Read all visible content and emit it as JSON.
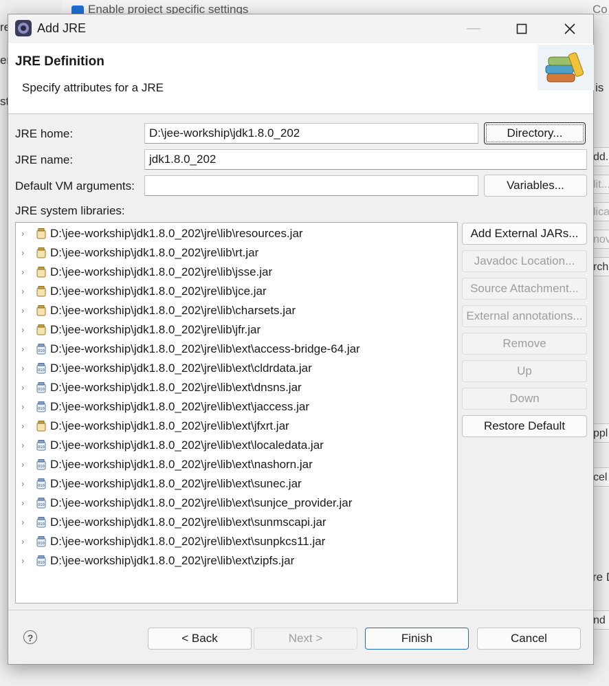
{
  "background": {
    "checkbox_label": "Enable project specific settings",
    "left_fragments": [
      "re",
      "er",
      "st"
    ],
    "right_fragments": [
      "is",
      "dd...",
      "lit...",
      "lica",
      "nov",
      "rch",
      "ppl",
      "cel",
      "re D",
      "nd C"
    ],
    "right_top": "Co"
  },
  "dialog": {
    "title": "Add JRE",
    "header_title": "JRE Definition",
    "header_subtitle": "Specify attributes for a JRE",
    "jre_home_label": "JRE home:",
    "jre_home_value": "D:\\jee-workship\\jdk1.8.0_202",
    "directory_button": "Directory...",
    "jre_name_label": "JRE name:",
    "jre_name_value": "jdk1.8.0_202",
    "vm_args_label": "Default VM arguments:",
    "vm_args_value": "",
    "variables_button": "Variables...",
    "system_libraries_label": "JRE system libraries:",
    "libraries": [
      {
        "path": "D:\\jee-workship\\jdk1.8.0_202\\jre\\lib\\resources.jar",
        "icon": "jar-icon"
      },
      {
        "path": "D:\\jee-workship\\jdk1.8.0_202\\jre\\lib\\rt.jar",
        "icon": "jar-icon"
      },
      {
        "path": "D:\\jee-workship\\jdk1.8.0_202\\jre\\lib\\jsse.jar",
        "icon": "jar-icon"
      },
      {
        "path": "D:\\jee-workship\\jdk1.8.0_202\\jre\\lib\\jce.jar",
        "icon": "jar-icon"
      },
      {
        "path": "D:\\jee-workship\\jdk1.8.0_202\\jre\\lib\\charsets.jar",
        "icon": "jar-icon"
      },
      {
        "path": "D:\\jee-workship\\jdk1.8.0_202\\jre\\lib\\jfr.jar",
        "icon": "jar-icon"
      },
      {
        "path": "D:\\jee-workship\\jdk1.8.0_202\\jre\\lib\\ext\\access-bridge-64.jar",
        "icon": "binary-jar-icon"
      },
      {
        "path": "D:\\jee-workship\\jdk1.8.0_202\\jre\\lib\\ext\\cldrdata.jar",
        "icon": "binary-jar-icon"
      },
      {
        "path": "D:\\jee-workship\\jdk1.8.0_202\\jre\\lib\\ext\\dnsns.jar",
        "icon": "binary-jar-icon"
      },
      {
        "path": "D:\\jee-workship\\jdk1.8.0_202\\jre\\lib\\ext\\jaccess.jar",
        "icon": "binary-jar-icon"
      },
      {
        "path": "D:\\jee-workship\\jdk1.8.0_202\\jre\\lib\\ext\\jfxrt.jar",
        "icon": "jar-icon"
      },
      {
        "path": "D:\\jee-workship\\jdk1.8.0_202\\jre\\lib\\ext\\localedata.jar",
        "icon": "binary-jar-icon"
      },
      {
        "path": "D:\\jee-workship\\jdk1.8.0_202\\jre\\lib\\ext\\nashorn.jar",
        "icon": "binary-jar-icon"
      },
      {
        "path": "D:\\jee-workship\\jdk1.8.0_202\\jre\\lib\\ext\\sunec.jar",
        "icon": "binary-jar-icon"
      },
      {
        "path": "D:\\jee-workship\\jdk1.8.0_202\\jre\\lib\\ext\\sunjce_provider.jar",
        "icon": "binary-jar-icon"
      },
      {
        "path": "D:\\jee-workship\\jdk1.8.0_202\\jre\\lib\\ext\\sunmscapi.jar",
        "icon": "binary-jar-icon"
      },
      {
        "path": "D:\\jee-workship\\jdk1.8.0_202\\jre\\lib\\ext\\sunpkcs11.jar",
        "icon": "binary-jar-icon"
      },
      {
        "path": "D:\\jee-workship\\jdk1.8.0_202\\jre\\lib\\ext\\zipfs.jar",
        "icon": "binary-jar-icon"
      }
    ],
    "side_buttons": [
      {
        "label": "Add External JARs...",
        "enabled": true
      },
      {
        "label": "Javadoc Location...",
        "enabled": false
      },
      {
        "label": "Source Attachment...",
        "enabled": false
      },
      {
        "label": "External annotations...",
        "enabled": false
      },
      {
        "label": "Remove",
        "enabled": false
      },
      {
        "label": "Up",
        "enabled": false
      },
      {
        "label": "Down",
        "enabled": false
      },
      {
        "label": "Restore Default",
        "enabled": true
      }
    ],
    "footer": {
      "back": "< Back",
      "next": "Next >",
      "finish": "Finish",
      "cancel": "Cancel",
      "help": "?"
    }
  },
  "colors": {
    "accent": "#1c6fbf",
    "dialog_bg": "#f0f0f0",
    "header_bg": "#ffffff"
  }
}
